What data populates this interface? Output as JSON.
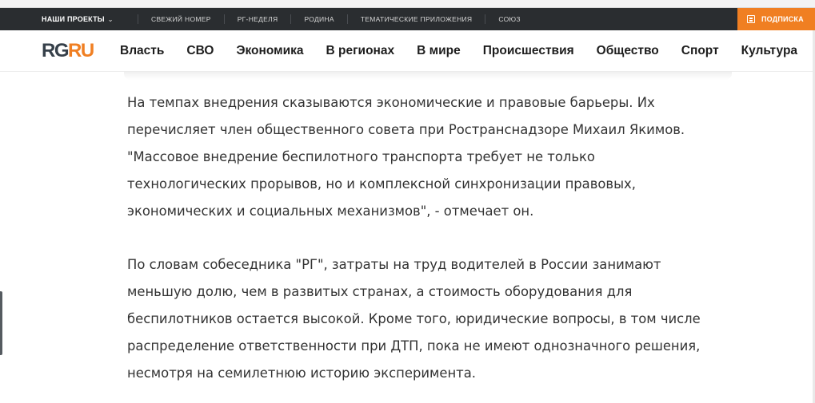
{
  "top_bar": {
    "projects_label": "НАШИ ПРОЕКТЫ",
    "links": [
      "СВЕЖИЙ НОМЕР",
      "РГ-НЕДЕЛЯ",
      "РОДИНА",
      "ТЕМАТИЧЕСКИЕ ПРИЛОЖЕНИЯ",
      "СОЮЗ"
    ],
    "subscribe_label": "ПОДПИСКА"
  },
  "logo": {
    "rg": "RG",
    "ru": "RU"
  },
  "nav": {
    "items": [
      "Власть",
      "СВО",
      "Экономика",
      "В регионах",
      "В мире",
      "Происшествия",
      "Общество",
      "Спорт",
      "Культура"
    ]
  },
  "article": {
    "paragraphs": [
      {
        "lines": [
          "На темпах внедрения сказываются экономические и правовые барьеры. Их",
          "перечисляет член общественного совета при Ространснадзоре Михаил Якимов.",
          "\"Массовое внедрение беспилотного транспорта требует не только",
          "технологических прорывов, но и комплексной синхронизации правовых,",
          "экономических и социальных механизмов\", - отмечает он."
        ]
      },
      {
        "lines": [
          "По словам собеседника \"РГ\", затраты на труд водителей в России занимают",
          "меньшую долю, чем в развитых странах, а стоимость оборудования для",
          "беспилотников остается высокой. Кроме того, юридические вопросы, в том числе",
          "распределение ответственности при ДТП, пока не имеют однозначного решения,",
          "несмотря на семилетнюю историю эксперимента."
        ]
      }
    ]
  },
  "colors": {
    "top_bar_bg": "#2a2d30",
    "accent_orange": "#f07f22",
    "logo_dark": "#36404a",
    "body_text": "#333333"
  },
  "icons": {
    "projects_dropdown": "chevron-down-icon",
    "subscribe": "newspaper-icon"
  }
}
